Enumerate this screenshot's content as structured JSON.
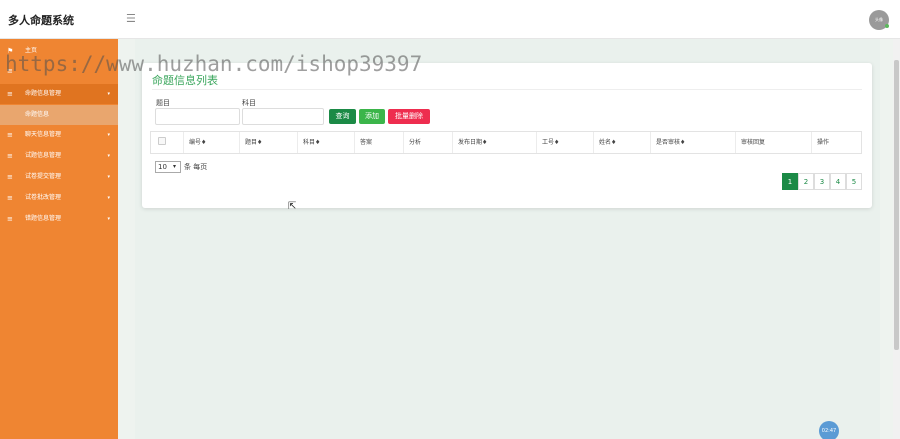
{
  "app": {
    "title": "多人命题系统",
    "menu_toggle_icon": "hamburger-icon",
    "avatar_text": "头像"
  },
  "sidebar": {
    "items": [
      {
        "label": "主页",
        "icon": "flag-icon"
      },
      {
        "label": "",
        "icon": "list-icon"
      },
      {
        "label": "命题信息管理",
        "icon": "list-icon"
      },
      {
        "label": "聊天信息管理",
        "icon": "list-icon"
      },
      {
        "label": "试题信息管理",
        "icon": "list-icon"
      },
      {
        "label": "试卷提交管理",
        "icon": "list-icon"
      },
      {
        "label": "试卷批改管理",
        "icon": "list-icon"
      },
      {
        "label": "错题信息管理",
        "icon": "list-icon"
      }
    ],
    "sub_item": "命题信息"
  },
  "card": {
    "title": "命题信息列表",
    "filters": [
      {
        "label": "题目",
        "value": ""
      },
      {
        "label": "科目",
        "value": ""
      }
    ],
    "buttons": {
      "query": "查询",
      "add": "添加",
      "batch_delete": "批量删除"
    },
    "columns": [
      "编号♦",
      "题目♦",
      "科目♦",
      "答案",
      "分析",
      "发布日期♦",
      "工号♦",
      "姓名♦",
      "是否审核♦",
      "审核回复",
      "操作"
    ],
    "page_size": "10",
    "page_size_suffix": "条 每页",
    "pages": [
      "1",
      "2",
      "3",
      "4",
      "5"
    ],
    "current_page": "1"
  },
  "watermark": "https://www.huzhan.com/ishop39397",
  "float_button": "02:47",
  "colors": {
    "sidebar": "#ef8532",
    "primary": "#1b8a46",
    "add": "#3bb54a",
    "danger": "#ee2d4f",
    "title": "#3aa65c"
  }
}
